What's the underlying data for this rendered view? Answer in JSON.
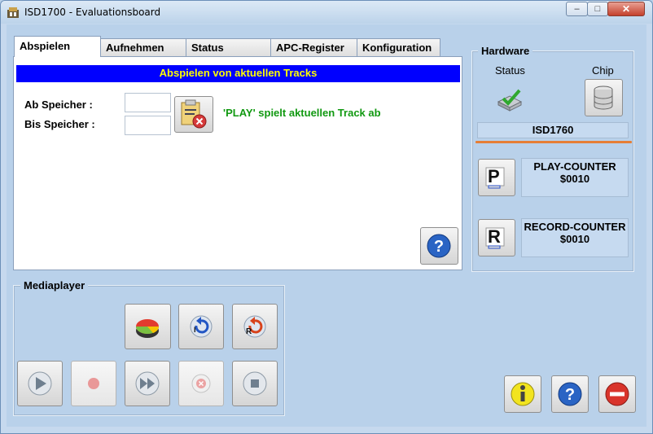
{
  "window": {
    "title": "ISD1700 - Evaluationsboard"
  },
  "window_controls": {
    "minimize": "–",
    "maximize": "□",
    "close": "✕"
  },
  "tabs": [
    {
      "label": "Abspielen",
      "active": true
    },
    {
      "label": "Aufnehmen",
      "active": false
    },
    {
      "label": "Status",
      "active": false
    },
    {
      "label": "APC-Register",
      "active": false
    },
    {
      "label": "Konfiguration",
      "active": false
    }
  ],
  "play_tab": {
    "banner": "Abspielen von aktuellen Tracks",
    "from_label": "Ab Speicher :",
    "to_label": "Bis Speicher :",
    "from_value": "",
    "to_value": "",
    "hint": "'PLAY' spielt aktuellen Track ab"
  },
  "mediaplayer": {
    "title": "Mediaplayer"
  },
  "hardware": {
    "title": "Hardware",
    "status_label": "Status",
    "chip_label": "Chip",
    "chip_name": "ISD1760",
    "play_counter_label": "PLAY-COUNTER",
    "play_counter_value": "$0010",
    "record_counter_label": "RECORD-COUNTER",
    "record_counter_value": "$0010"
  },
  "colors": {
    "banner_bg": "#0000ff",
    "banner_text": "#ffff00",
    "hint_text": "#119911",
    "accent_line": "#e67e36"
  }
}
